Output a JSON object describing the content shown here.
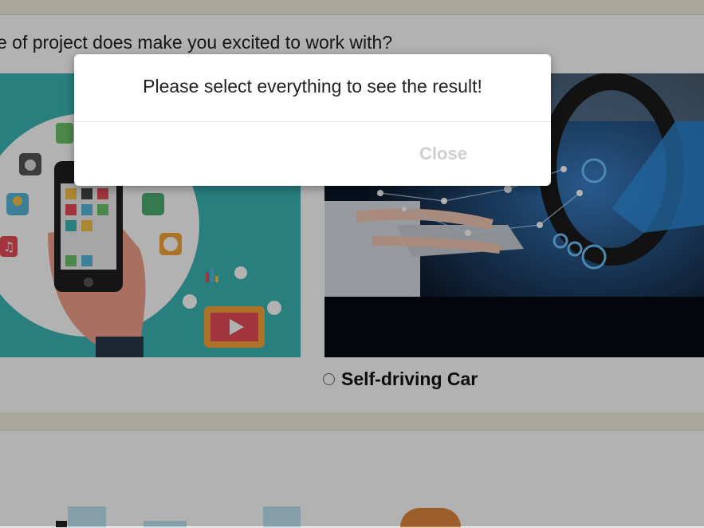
{
  "question": {
    "text": "e of project does make you excited to work with?"
  },
  "options": [
    {
      "label": "Self-driving Car"
    }
  ],
  "modal": {
    "message": "Please select everything to see the result!",
    "close_label": "Close"
  },
  "colors": {
    "page_band": "#f2f0da",
    "teal": "#3bb5b5",
    "car_dark": "#0b1626",
    "glow": "#3aa0ff"
  },
  "icons": {
    "app_image": "smartphone-apps-illustration",
    "car_image": "self-driving-car-dashboard",
    "radio": "radio-unchecked-icon"
  }
}
